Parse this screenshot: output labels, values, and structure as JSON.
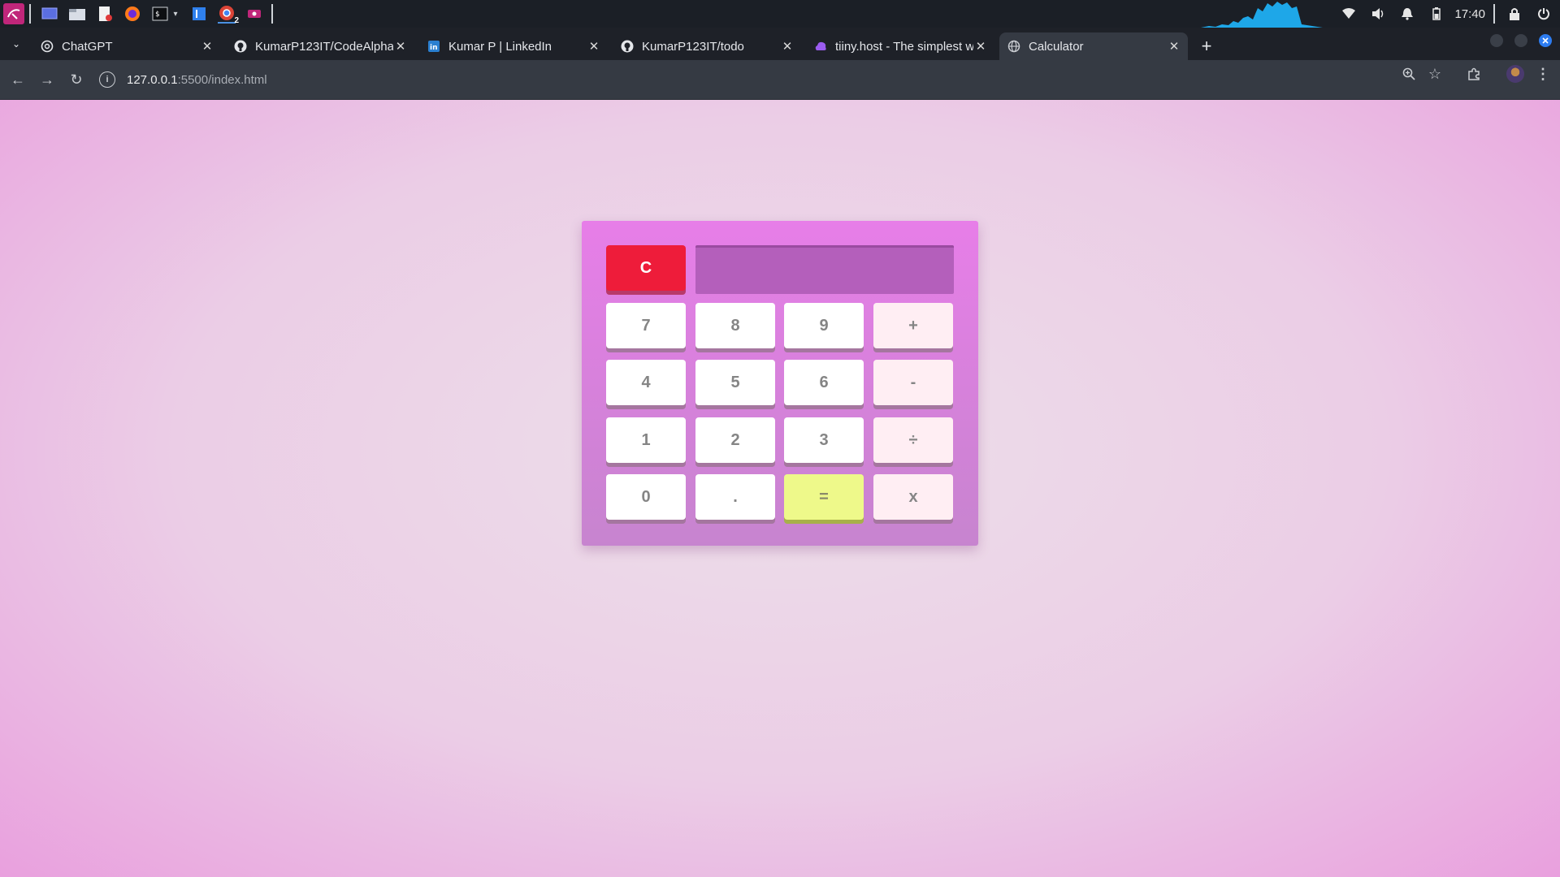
{
  "system": {
    "clock": "17:40",
    "taskbar_badge": "2"
  },
  "browser": {
    "tabs": [
      {
        "title": "ChatGPT",
        "icon": "openai-icon",
        "active": false
      },
      {
        "title": "KumarP123IT/CodeAlpha",
        "icon": "github-icon",
        "active": false
      },
      {
        "title": "Kumar P | LinkedIn",
        "icon": "linkedin-icon",
        "active": false
      },
      {
        "title": "KumarP123IT/todo",
        "icon": "github-icon",
        "active": false
      },
      {
        "title": "tiiny.host - The simplest w",
        "icon": "tiiny-host-icon",
        "active": false
      },
      {
        "title": "Calculator",
        "icon": "globe-icon",
        "active": true
      }
    ],
    "address": {
      "host": "127.0.0.1",
      "path": ":5500/index.html"
    }
  },
  "calculator": {
    "display_value": "",
    "clear_label": "C",
    "keys": [
      [
        "7",
        "8",
        "9",
        "+"
      ],
      [
        "4",
        "5",
        "6",
        "-"
      ],
      [
        "1",
        "2",
        "3",
        "÷"
      ],
      [
        "0",
        ".",
        "=",
        "x"
      ]
    ]
  },
  "colors": {
    "page_bg": "#e8cde4",
    "calculator_bg": "#e77ee8",
    "display_bg": "#b45fbb",
    "clear_button": "#ee1c3a",
    "equals_button": "#eef98a",
    "operator_button": "#ffeef3",
    "number_button": "#ffffff"
  }
}
